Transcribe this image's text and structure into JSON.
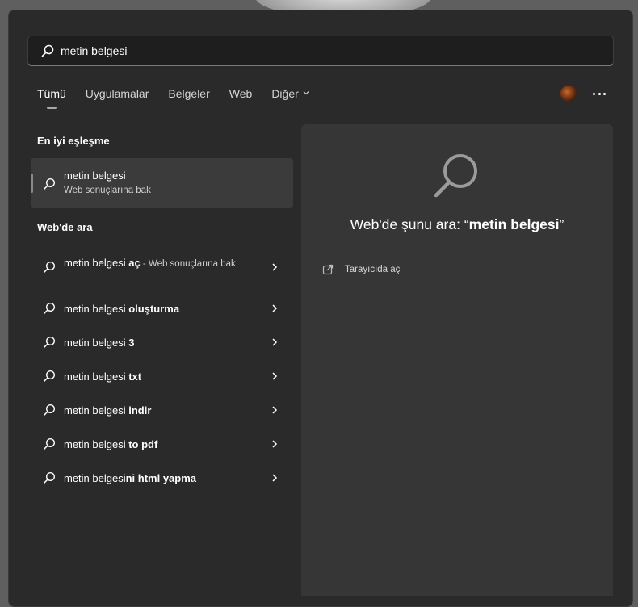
{
  "search": {
    "query": "metin belgesi"
  },
  "tabs": [
    {
      "label": "Tümü"
    },
    {
      "label": "Uygulamalar"
    },
    {
      "label": "Belgeler"
    },
    {
      "label": "Web"
    },
    {
      "label": "Diğer"
    }
  ],
  "best_match": {
    "heading": "En iyi eşleşme",
    "title": "metin belgesi",
    "subtitle": "Web sonuçlarına bak"
  },
  "web_search": {
    "heading": "Web'de ara",
    "first": {
      "prefix": "metin belgesi ",
      "bold": "aç",
      "suffix": " - ",
      "sub": "Web sonuçlarına bak"
    },
    "suggestions": [
      {
        "prefix": "metin belgesi ",
        "bold": "oluşturma"
      },
      {
        "prefix": "metin belgesi ",
        "bold": "3"
      },
      {
        "prefix": "metin belgesi ",
        "bold": "txt"
      },
      {
        "prefix": "metin belgesi ",
        "bold": "indir"
      },
      {
        "prefix": "metin belgesi ",
        "bold": "to pdf"
      },
      {
        "prefix": "metin belgesi",
        "bold": "ni html yapma"
      }
    ]
  },
  "preview": {
    "prefix": "Web'de şunu ara: “",
    "query": "metin belgesi",
    "suffix": "”",
    "open_in_browser": "Tarayıcıda aç"
  },
  "icons": {
    "search": "search-icon",
    "chevron_down": "chevron-down-icon",
    "chevron_right": "chevron-right-icon",
    "more": "more-options-icon",
    "external": "open-external-icon"
  },
  "colors": {
    "panel": "#2a2a2a",
    "pane": "#363636",
    "highlight": "#3b3b3b"
  }
}
